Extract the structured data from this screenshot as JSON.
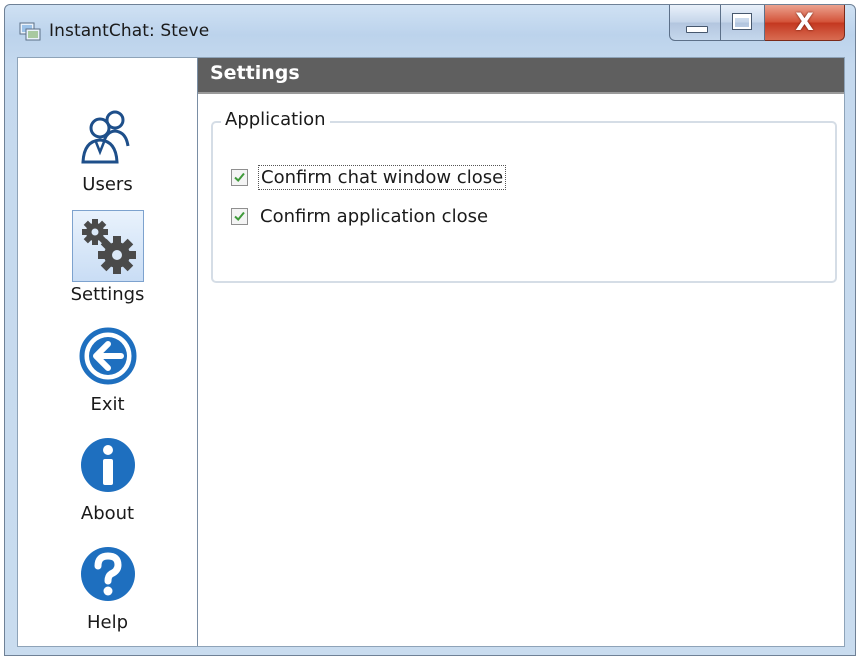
{
  "window": {
    "title": "InstantChat: Steve",
    "close_glyph": "X"
  },
  "sidebar": {
    "items": [
      {
        "label": "Users",
        "icon": "users-icon"
      },
      {
        "label": "Settings",
        "icon": "gears-icon",
        "selected": true
      },
      {
        "label": "Exit",
        "icon": "back-arrow-icon"
      },
      {
        "label": "About",
        "icon": "info-icon"
      },
      {
        "label": "Help",
        "icon": "help-icon"
      }
    ]
  },
  "main": {
    "header": {
      "title": "Settings"
    },
    "group": {
      "title": "Application",
      "options": [
        {
          "label": "Confirm chat window close",
          "checked": true
        },
        {
          "label": "Confirm application close",
          "checked": true
        }
      ]
    }
  },
  "colors": {
    "header_bg": "#5f5f5f",
    "accent_blue": "#1e6fbf",
    "check_green": "#3f9a3a"
  }
}
